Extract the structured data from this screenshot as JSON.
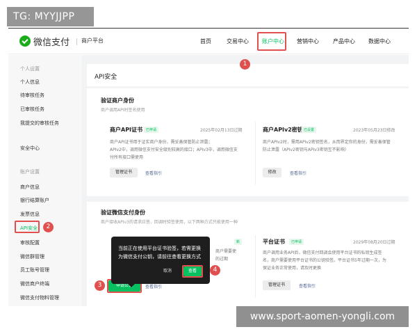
{
  "watermarks": {
    "top_left": "TG: MYYJJPP",
    "bottom_right": "www.sport-aomen-yongli.com"
  },
  "header": {
    "brand": "微信支付",
    "platform": "商户平台",
    "nav": [
      "首页",
      "交易中心",
      "账户中心",
      "营销中心",
      "产品中心",
      "数据中心"
    ],
    "active_nav": "账户中心"
  },
  "sidebar": {
    "group1": "个人设置",
    "items1": [
      "个人信息",
      "待审核任务",
      "已审核任务",
      "我提交的审核任务"
    ],
    "security": "安全中心",
    "group2": "账户设置",
    "items2": [
      "商户信息",
      "银行结算账户",
      "发票信息",
      "API安全",
      "审核配置",
      "微信群管理",
      "员工账号管理",
      "微信商户终端",
      "微信支付物料管理"
    ],
    "active_item": "API安全"
  },
  "page_title": "API安全",
  "verify_merchant": {
    "title": "验证商户身份",
    "subtitle": "商户调用API时签名使用",
    "cert": {
      "title": "商户API证书",
      "tag": "已申请",
      "date": "2025年02月13日过期",
      "desc_lines": [
        "商户API证书用于证实商户身份，需妥善保管防止泄露；",
        "APIv2中，调用微信支付安全级别较高的接口；APIv3中，调用微信支",
        "付所有接口需使用"
      ],
      "button": "管理证书",
      "link": "查看指引"
    },
    "apiv2": {
      "title": "商户APIv2密钥",
      "tag": "已设置",
      "date": "2023年05月23日修改",
      "desc_lines": [
        "商户APIv2时，需用APIv2密钥签名，从而界定你的身份，需妥善保管",
        "防止泄露（APIv2密钥与APIv3密钥互不影响）"
      ],
      "button": "修改",
      "link": "查看指引"
    }
  },
  "verify_wechat": {
    "title": "验证微信支付身份",
    "subtitle": "商户接收APIv3的请求应答，回调时验签使用，以下两种方式只能使用一种",
    "left_tag": "新",
    "left_desc": [
      "商户需要使",
      "的过期"
    ],
    "apply_button": "申请公钥",
    "left_link": "查看指引",
    "platform_cert": {
      "title": "平台证书",
      "tag": "已申请",
      "date": "2029年08月20日过期",
      "desc_lines": [
        "商户调用业务API后，微信支付回调会使用平台证书的私钥生成签",
        "名，商户需要使用平台证书的公钥验签。平台证书5年过期一次，为",
        "保证业务正常使用，请及时更换"
      ],
      "button": "管理证书",
      "link": "查看指引"
    }
  },
  "popover": {
    "text": "当前正在使用平台证书验签，若需更换为微信支付公钥，请前往查看更换方式",
    "cancel": "取消",
    "confirm": "查看"
  },
  "markers": [
    "1",
    "2",
    "3",
    "4"
  ],
  "colors": {
    "accent": "#07c160",
    "highlight": "#e0504f",
    "link": "#576b95"
  }
}
